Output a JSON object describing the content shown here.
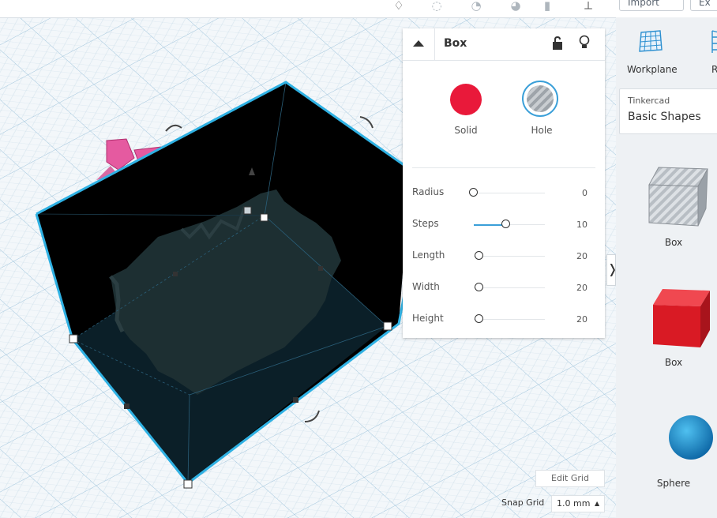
{
  "toolbar": {
    "import_label": "Import",
    "export_label": "Ex"
  },
  "inspector": {
    "title": "Box",
    "solid_label": "Solid",
    "hole_label": "Hole",
    "solid_color": "#e9193a",
    "properties": [
      {
        "label": "Radius",
        "value": "0",
        "slider": 0.0
      },
      {
        "label": "Steps",
        "value": "10",
        "slider": 0.45
      },
      {
        "label": "Length",
        "value": "20",
        "slider": 0.08
      },
      {
        "label": "Width",
        "value": "20",
        "slider": 0.08
      },
      {
        "label": "Height",
        "value": "20",
        "slider": 0.08
      }
    ]
  },
  "panel": {
    "workplane_label": "Workplane",
    "ruler_label": "R",
    "library_source": "Tinkercad",
    "library_name": "Basic Shapes",
    "shapes": [
      {
        "label": "Box",
        "kind": "hole-box"
      },
      {
        "label": "Box",
        "kind": "solid-box",
        "color": "#e0192b"
      },
      {
        "label": "Sphere",
        "kind": "sphere",
        "color": "#1f8fd0"
      }
    ]
  },
  "grid": {
    "edit_grid_label": "Edit Grid",
    "snap_grid_label": "Snap Grid",
    "snap_value": "1.0 mm"
  },
  "colors": {
    "accent": "#3a9fd8",
    "selection": "#2fb1e3",
    "hole_dark": "#000000"
  }
}
